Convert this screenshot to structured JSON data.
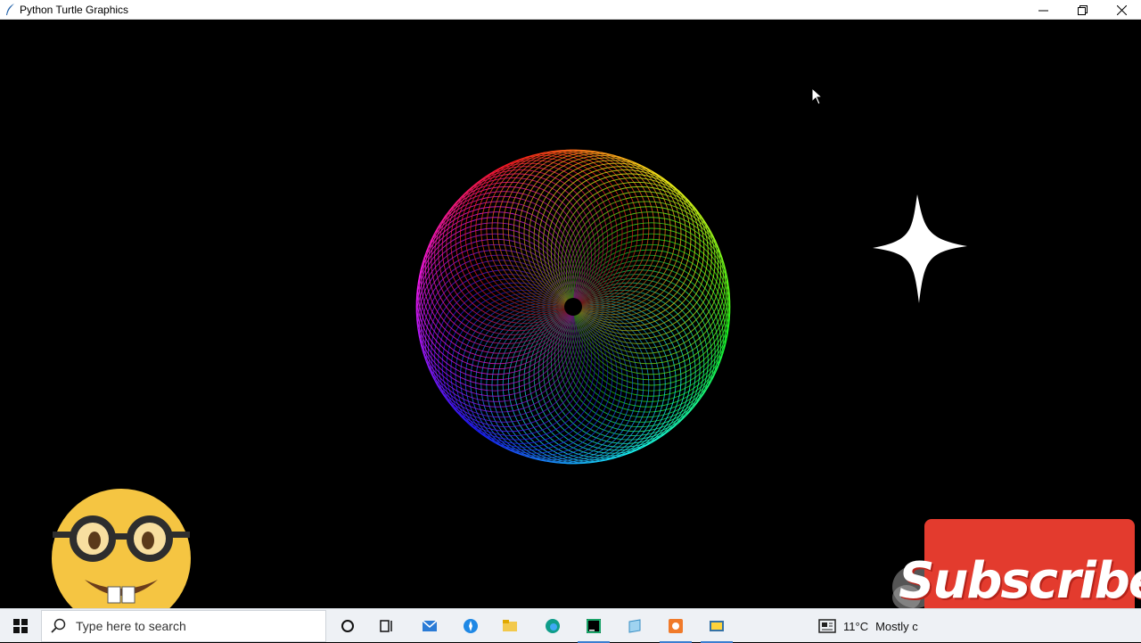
{
  "window": {
    "title": "Python Turtle Graphics",
    "icons": {
      "app": "feather-icon",
      "minimize": "minimize-icon",
      "restore": "restore-icon",
      "close": "close-icon"
    }
  },
  "canvas": {
    "background": "#000000",
    "drawing": "rainbow-spiral-sphere",
    "overlays": {
      "cursor": "mouse-pointer-icon",
      "sparkle": "four-point-star-icon",
      "emoji": "nerd-face-emoji"
    }
  },
  "subscribe": {
    "label": "Subscribe",
    "color": "#e33b2e"
  },
  "taskbar": {
    "search": {
      "placeholder": "Type here to search"
    },
    "apps": [
      {
        "name": "cortana-icon",
        "active": false
      },
      {
        "name": "task-view-icon",
        "active": false
      },
      {
        "name": "mail-icon",
        "active": false
      },
      {
        "name": "safari-compass-icon",
        "active": false
      },
      {
        "name": "file-explorer-icon",
        "active": false
      },
      {
        "name": "edge-icon",
        "active": false
      },
      {
        "name": "pycharm-icon",
        "active": true
      },
      {
        "name": "notepad-icon",
        "active": false
      },
      {
        "name": "recorder-icon",
        "active": true
      },
      {
        "name": "python-icon",
        "active": true
      }
    ],
    "weather": {
      "temperature": "11°C",
      "condition": "Mostly c"
    }
  }
}
